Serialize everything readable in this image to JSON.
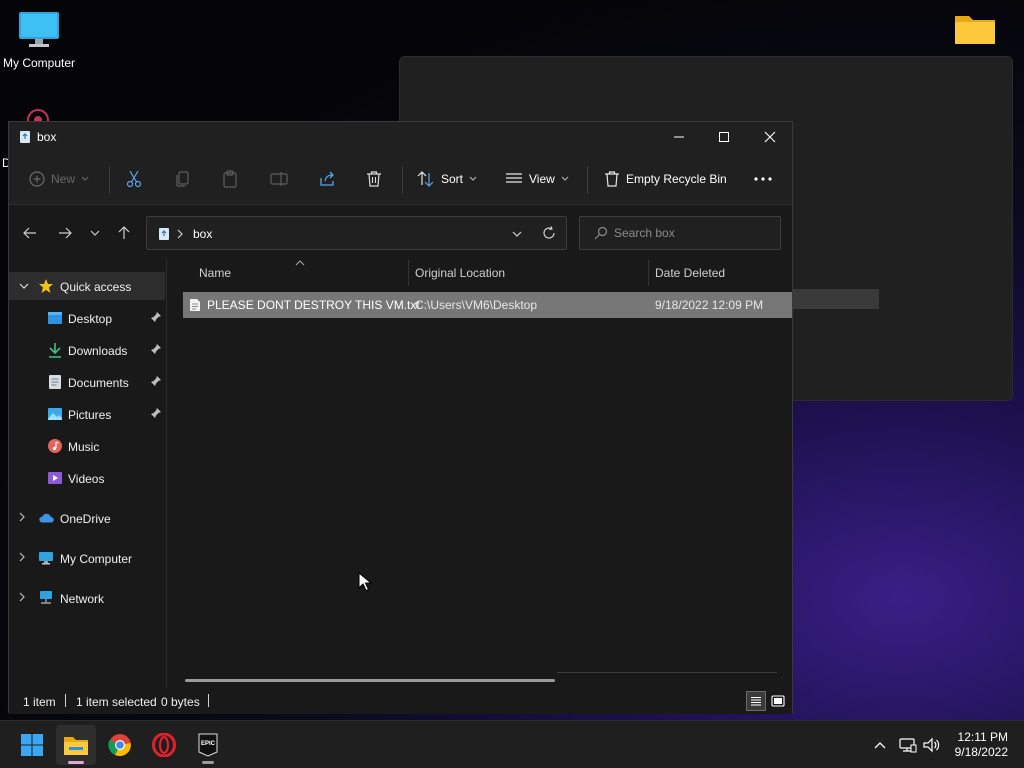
{
  "desktop": {
    "icons": [
      {
        "label": "My Computer"
      },
      {
        "label": "D"
      }
    ]
  },
  "window": {
    "title": "box",
    "controls": {
      "minimize": "minimize",
      "maximize": "maximize",
      "close": "close"
    }
  },
  "toolbar": {
    "new_label": "New",
    "sort_label": "Sort",
    "view_label": "View",
    "empty_label": "Empty Recycle Bin"
  },
  "address": {
    "path": "box",
    "search_placeholder": "Search box"
  },
  "sidebar": {
    "items": [
      {
        "label": "Quick access",
        "icon": "star-icon"
      },
      {
        "label": "Desktop",
        "icon": "desktop-folder-icon"
      },
      {
        "label": "Downloads",
        "icon": "download-icon"
      },
      {
        "label": "Documents",
        "icon": "document-icon"
      },
      {
        "label": "Pictures",
        "icon": "picture-icon"
      },
      {
        "label": "Music",
        "icon": "music-icon"
      },
      {
        "label": "Videos",
        "icon": "video-icon"
      },
      {
        "label": "OneDrive",
        "icon": "cloud-icon"
      },
      {
        "label": "My Computer",
        "icon": "computer-icon"
      },
      {
        "label": "Network",
        "icon": "network-icon"
      }
    ]
  },
  "columns": {
    "name": "Name",
    "location": "Original Location",
    "date": "Date Deleted"
  },
  "files": [
    {
      "name": "PLEASE DONT DESTROY THIS VM.txt",
      "location": "C:\\Users\\VM6\\Desktop",
      "date": "9/18/2022 12:09 PM"
    }
  ],
  "status": {
    "count": "1 item",
    "selection": "1 item selected",
    "size": "0 bytes"
  },
  "taskbar": {
    "apps": [
      "start",
      "file-explorer",
      "chrome",
      "opera",
      "epic-games"
    ],
    "time": "12:11 PM",
    "date": "9/18/2022"
  },
  "colors": {
    "accent": "#0078d4",
    "selected_row": "#777777",
    "taskbar": "#1f1f1f"
  }
}
